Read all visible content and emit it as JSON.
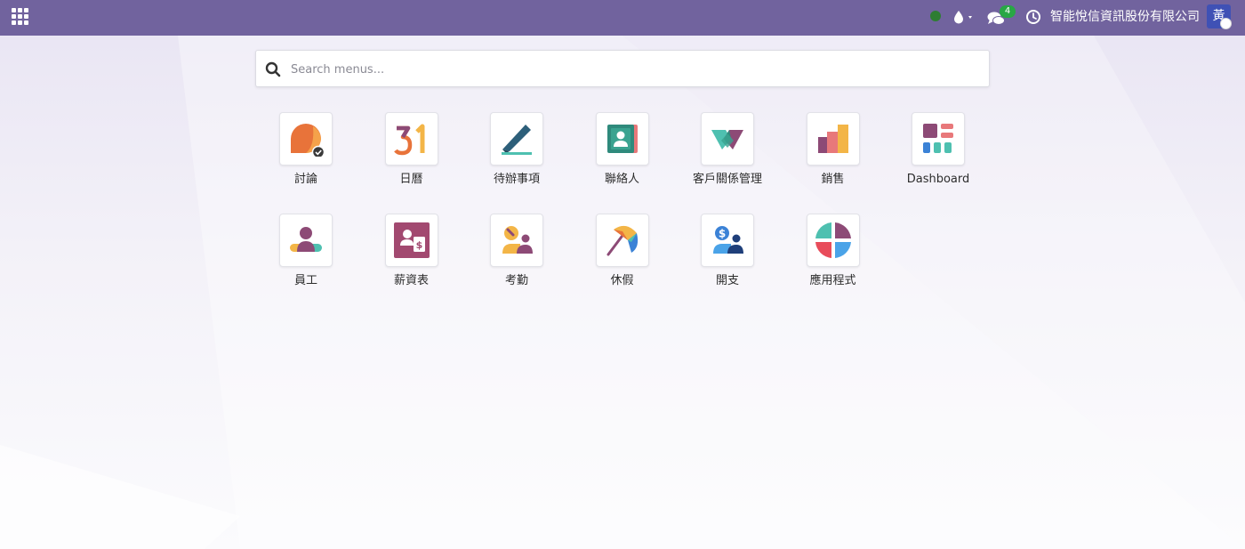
{
  "navbar": {
    "apps_icon": "apps-grid-icon",
    "presence_icon": "online-status-dot",
    "activity_icon": "water-drop-icon",
    "messages_icon": "chat-bubbles-icon",
    "messages_count": "4",
    "clock_icon": "clock-icon",
    "company_name": "智能悅信資訊股份有限公司",
    "avatar_initial": "黃",
    "colors": {
      "bar": "#71639e",
      "badge": "#28a745",
      "online": "#2e7d32"
    }
  },
  "search": {
    "placeholder": "Search menus..."
  },
  "apps": [
    {
      "label": "討論",
      "icon": "discuss-icon"
    },
    {
      "label": "日曆",
      "icon": "calendar-icon"
    },
    {
      "label": "待辦事項",
      "icon": "todo-icon"
    },
    {
      "label": "聯絡人",
      "icon": "contacts-icon"
    },
    {
      "label": "客戶關係管理",
      "icon": "crm-icon"
    },
    {
      "label": "銷售",
      "icon": "sales-icon"
    },
    {
      "label": "Dashboard",
      "icon": "dashboard-icon"
    },
    {
      "label": "員工",
      "icon": "employees-icon"
    },
    {
      "label": "薪資表",
      "icon": "payroll-icon"
    },
    {
      "label": "考勤",
      "icon": "attendance-icon"
    },
    {
      "label": "休假",
      "icon": "time-off-icon"
    },
    {
      "label": "開支",
      "icon": "expenses-icon"
    },
    {
      "label": "應用程式",
      "icon": "apps-icon"
    }
  ]
}
